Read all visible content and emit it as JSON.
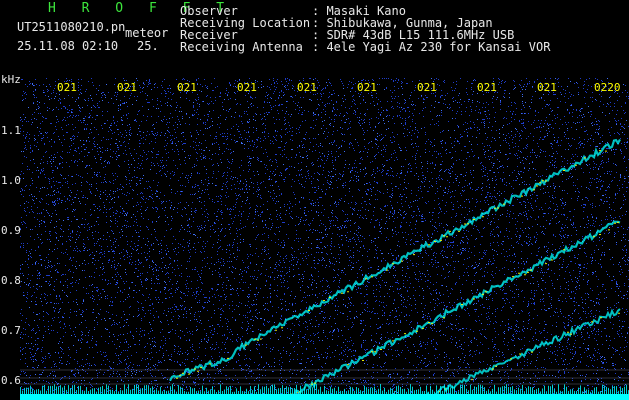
{
  "header": {
    "title": "H R O F F T",
    "filename": "UT2511080210.pn",
    "meteor_label": "meteor",
    "date_time": "25.11.08 02:10",
    "level": "25.",
    "info_labels": [
      "Observer",
      "Receiving Location",
      "Receiver",
      "Receiving Antenna"
    ],
    "info_values": [
      ": Masaki Kano",
      ": Shibukawa, Gunma, Japan",
      ": SDR# 43dB L15 111.6MHz USB",
      ": 4ele Yagi Az 230 for Kansai VOR"
    ]
  },
  "axis": {
    "unit": "kHz",
    "y_labels": [
      "1.1",
      "1.0",
      "0.9",
      "0.8",
      "0.7",
      "0.6"
    ],
    "time_labels": [
      "021",
      "021",
      "021",
      "021",
      "021",
      "021",
      "021",
      "021",
      "021",
      "0220"
    ]
  },
  "colors": {
    "background": "#000000",
    "noise": "#1e3cc8",
    "signal": "#00ffff",
    "hot": "#ffff00",
    "title": "#3de63d",
    "text": "#e8e8e8",
    "ticks": "#ffff00"
  }
}
